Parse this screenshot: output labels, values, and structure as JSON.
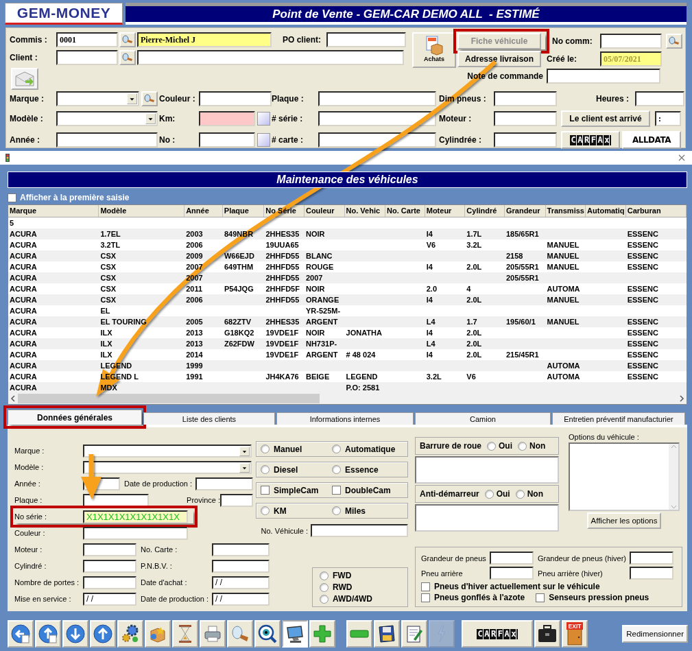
{
  "app": {
    "logo": "GEM-MONEY",
    "title": "Point de Vente - GEM-CAR DEMO ALL  - ESTIMÉ"
  },
  "order": {
    "commis": {
      "label": "Commis :",
      "code": "0001",
      "name": "Pierre-Michel J"
    },
    "client_label": "Client :",
    "po_client_label": "PO client:",
    "achats_button": "Achats",
    "fiche_button": {
      "label": "Fiche véhicule",
      "disabled": true,
      "highlighted": true
    },
    "adresse_button": {
      "label": "Adresse livraison",
      "disabled": false,
      "highlighted": false
    },
    "no_comm_label": "No comm:",
    "cree_le": {
      "label": "Créé le:",
      "value": "05/07/2021"
    },
    "note_label": "Note de commande",
    "marque_label": "Marque :",
    "modele_label": "Modèle :",
    "annee_label": "Année :",
    "couleur_label": "Couleur :",
    "km_label": "Km:",
    "no_label": "No :",
    "plaque_label": "Plaque :",
    "serie_label": "# série :",
    "carte_label": "# carte :",
    "dim_pneus_label": "Dim pneus :",
    "moteur_label": "Moteur :",
    "cylindree_label": "Cylindrée :",
    "heures_label": "Heures :",
    "arrive_button": "Le client est arrivé",
    "time_value": ":",
    "carfax_logo": "CARFAx",
    "alldata_logo": "ALLDATA"
  },
  "maintenance": {
    "title": "Maintenance des véhicules",
    "show_first": {
      "label": "Afficher à la première saisie",
      "checked": false
    },
    "columns": [
      "Marque",
      "Modèle",
      "Année",
      "Plaque",
      "No Série",
      "Couleur",
      "No. Vehic",
      "No. Carte",
      "Moteur",
      "Cylindré",
      "Grandeur",
      "Transmiss",
      "Automatiq",
      "Carburan"
    ],
    "rows": [
      [
        "5"
      ],
      [
        "ACURA",
        "1.7EL",
        "2003",
        "849NBR",
        "2HHES35",
        "NOIR",
        null,
        null,
        "I4",
        "1.7L",
        "185/65R1",
        null,
        null,
        "ESSENC"
      ],
      [
        "ACURA",
        "3.2TL",
        "2006",
        null,
        "19UUA65",
        null,
        null,
        null,
        "V6",
        "3.2L",
        null,
        "MANUEL",
        null,
        "ESSENC"
      ],
      [
        "ACURA",
        "CSX",
        "2009",
        "W66EJD",
        "2HHFD55",
        "BLANC",
        null,
        null,
        null,
        null,
        "2158",
        "MANUEL",
        null,
        "ESSENC"
      ],
      [
        "ACURA",
        "CSX",
        "2007",
        "649THM",
        "2HHFD55",
        "ROUGE",
        null,
        null,
        "I4",
        "2.0L",
        "205/55R1",
        "MANUEL",
        null,
        "ESSENC"
      ],
      [
        "ACURA",
        "CSX",
        "2007",
        null,
        "2HHFD55",
        "2007",
        null,
        null,
        null,
        null,
        "205/55R1"
      ],
      [
        "ACURA",
        "CSX",
        "2011",
        "P54JQG",
        "2HHFD5F",
        "NOIR",
        null,
        null,
        "2.0",
        "4",
        null,
        "AUTOMA",
        null,
        "ESSENC"
      ],
      [
        "ACURA",
        "CSX",
        "2006",
        null,
        "2HHFD55",
        "ORANGE",
        null,
        null,
        "I4",
        "2.0L",
        null,
        "MANUEL",
        null,
        "ESSENC"
      ],
      [
        "ACURA",
        "EL",
        null,
        null,
        null,
        "YR-525M-"
      ],
      [
        "ACURA",
        "EL TOURING",
        "2005",
        "682ZTV",
        "2HHES35",
        "ARGENT",
        null,
        null,
        "L4",
        "1.7",
        "195/60/1",
        "MANUEL",
        null,
        "ESSENC"
      ],
      [
        "ACURA",
        "ILX",
        "2013",
        "G18KQ2",
        "19VDE1F",
        "NOIR",
        "JONATHA",
        null,
        "I4",
        "2.0L",
        null,
        null,
        null,
        "ESSENC"
      ],
      [
        "ACURA",
        "ILX",
        "2013",
        "Z62FDW",
        "19VDE1F",
        "NH731P-",
        null,
        null,
        "L4",
        "2.0L",
        null,
        null,
        null,
        "ESSENC"
      ],
      [
        "ACURA",
        "ILX",
        "2014",
        null,
        "19VDE1F",
        "ARGENT",
        "# 48 024",
        null,
        "I4",
        "2.0L",
        "215/45R1",
        null,
        null,
        "ESSENC"
      ],
      [
        "ACURA",
        "LEGEND",
        "1999",
        null,
        null,
        null,
        null,
        null,
        null,
        null,
        null,
        "AUTOMA",
        null,
        "ESSENC"
      ],
      [
        "ACURA",
        "LEGEND L",
        "1991",
        null,
        "JH4KA76",
        "BEIGE",
        "LEGEND",
        null,
        "3.2L",
        "V6",
        null,
        "AUTOMA",
        null,
        "ESSENC"
      ],
      [
        "ACURA",
        "MDX",
        null,
        null,
        null,
        null,
        "P.O: 2581"
      ]
    ]
  },
  "tabs": [
    {
      "label": "Données générales",
      "selected": true,
      "highlighted": true
    },
    {
      "label": "Liste des clients",
      "selected": false,
      "highlighted": false
    },
    {
      "label": "Informations internes",
      "selected": false,
      "highlighted": false
    },
    {
      "label": "Camion",
      "selected": false,
      "highlighted": false
    },
    {
      "label": "Entretien préventif manufacturier",
      "selected": false,
      "highlighted": false
    }
  ],
  "general": {
    "rows": [
      {
        "highlighted": false,
        "fields": [
          {
            "label": "Marque :",
            "kind": "select"
          }
        ]
      },
      {
        "highlighted": false,
        "fields": [
          {
            "label": "Modèle :",
            "kind": "select"
          }
        ]
      },
      {
        "highlighted": false,
        "fields": [
          {
            "label": "Année :",
            "kind": "input"
          },
          {
            "label": "Date de production :",
            "kind": "input"
          }
        ]
      },
      {
        "highlighted": false,
        "fields": [
          {
            "label": "Plaque :",
            "kind": "input"
          },
          {
            "label": "Province :",
            "kind": "input"
          }
        ]
      },
      {
        "highlighted": true,
        "fields": [
          {
            "label": "No série :",
            "kind": "input",
            "value": "X1X1X1X1X1X1X1X1X"
          }
        ]
      },
      {
        "highlighted": false,
        "fields": [
          {
            "label": "Couleur :",
            "kind": "input"
          }
        ]
      },
      {
        "highlighted": false,
        "fields": [
          {
            "label": "Moteur :",
            "kind": "input"
          },
          {
            "label": "No. Carte :",
            "kind": "input"
          }
        ]
      },
      {
        "highlighted": false,
        "fields": [
          {
            "label": "Cylindré :",
            "kind": "input"
          },
          {
            "label": "P.N.B.V. :",
            "kind": "input"
          }
        ]
      },
      {
        "highlighted": false,
        "fields": [
          {
            "label": "Nombre de portes :",
            "kind": "input"
          },
          {
            "label": "Date d'achat :",
            "kind": "input",
            "value": "/ /"
          }
        ]
      },
      {
        "highlighted": false,
        "fields": [
          {
            "label": "Mise en service :",
            "kind": "input",
            "value": "/ /"
          },
          {
            "label": "Date de production :",
            "kind": "input",
            "value": "/ /"
          }
        ]
      }
    ],
    "option_groups": [
      {
        "kind": "radio",
        "options": [
          {
            "label": "Manuel",
            "checked": false
          },
          {
            "label": "Automatique",
            "checked": false
          }
        ]
      },
      {
        "kind": "radio",
        "options": [
          {
            "label": "Diesel",
            "checked": false
          },
          {
            "label": "Essence",
            "checked": false
          }
        ]
      },
      {
        "kind": "checkbox",
        "options": [
          {
            "label": "SimpleCam",
            "checked": false
          },
          {
            "label": "DoubleCam",
            "checked": false
          }
        ]
      },
      {
        "kind": "radio",
        "options": [
          {
            "label": "KM",
            "checked": false
          },
          {
            "label": "Miles",
            "checked": false
          }
        ]
      }
    ],
    "no_vehicule_label": "No. Véhicule :",
    "drive": [
      {
        "label": "FWD",
        "checked": false
      },
      {
        "label": "RWD",
        "checked": false
      },
      {
        "label": "AWD/4WD",
        "checked": false
      }
    ],
    "locks": [
      {
        "label": "Barrure de roue",
        "options": [
          {
            "label": "Oui",
            "checked": false
          },
          {
            "label": "Non",
            "checked": false
          }
        ]
      },
      {
        "label": "Anti-démarreur",
        "options": [
          {
            "label": "Oui",
            "checked": false
          },
          {
            "label": "Non",
            "checked": false
          }
        ]
      }
    ],
    "options_label": "Options du véhicule :",
    "options_button": "Afficher les options",
    "tires": {
      "size_label": "Grandeur de pneus",
      "winter_size_label": "Grandeur de pneus (hiver)",
      "rear_label": "Pneu arrière",
      "winter_rear_label": "Pneu arrière (hiver)",
      "checks": [
        {
          "label": "Pneus d'hiver actuellement sur le véhicule",
          "checked": false
        },
        {
          "label": "Pneus gonflés à l'azote",
          "checked": false
        },
        {
          "label": "Senseurs pression pneus",
          "checked": false
        }
      ]
    }
  },
  "toolbar": {
    "buttons": [
      {
        "kind": "globe-left",
        "pressed": false,
        "disabled": false
      },
      {
        "kind": "globe-up",
        "pressed": false,
        "disabled": false
      },
      {
        "kind": "arrow-down",
        "pressed": false,
        "disabled": false
      },
      {
        "kind": "arrow-up",
        "pressed": false,
        "disabled": false
      },
      {
        "kind": "gears",
        "pressed": false,
        "disabled": false
      },
      {
        "kind": "box",
        "pressed": false,
        "disabled": false
      },
      {
        "kind": "hourglass",
        "pressed": false,
        "disabled": false
      },
      {
        "kind": "printer",
        "pressed": false,
        "disabled": false
      },
      {
        "kind": "magnifier",
        "pressed": false,
        "disabled": false
      },
      {
        "kind": "eye",
        "pressed": false,
        "disabled": false
      },
      {
        "kind": "monitor",
        "pressed": true,
        "disabled": false
      },
      {
        "kind": "plus",
        "pressed": false,
        "disabled": false
      },
      {
        "kind": "minus",
        "pressed": false,
        "disabled": false
      },
      {
        "kind": "floppy",
        "pressed": false,
        "disabled": false
      },
      {
        "kind": "notepad",
        "pressed": false,
        "disabled": false
      },
      {
        "kind": "flash",
        "pressed": false,
        "disabled": true
      },
      {
        "kind": "carfax",
        "label": "CARFAx",
        "pressed": false,
        "disabled": false
      },
      {
        "kind": "briefcase",
        "pressed": false,
        "disabled": false
      },
      {
        "kind": "exit",
        "label": "EXIT",
        "pressed": false,
        "disabled": false
      }
    ],
    "resize_button": "Redimensionner"
  }
}
